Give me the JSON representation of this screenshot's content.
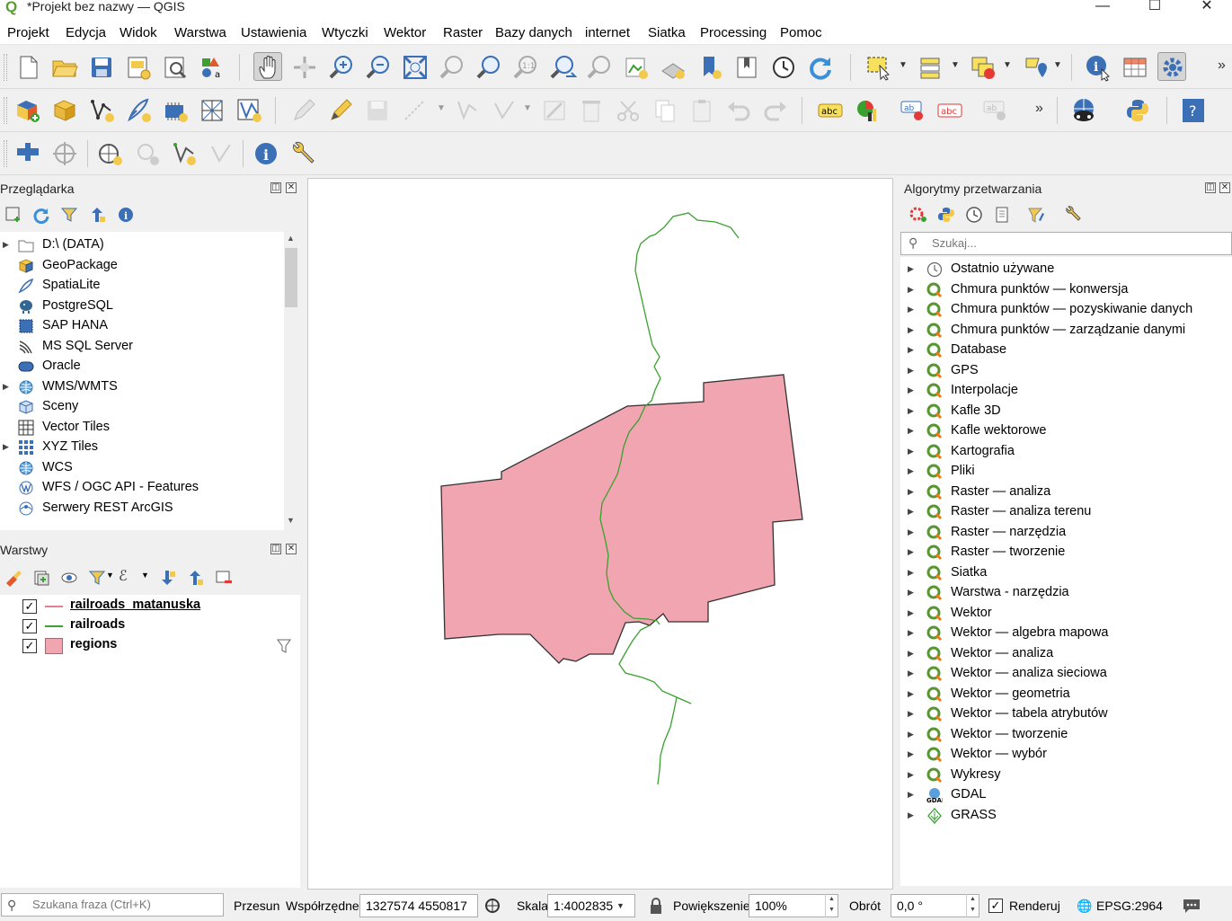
{
  "window": {
    "title": "*Projekt bez nazwy — QGIS",
    "minimize": "—",
    "maximize": "☐",
    "close": "✕"
  },
  "menu": [
    "Projekt",
    "Edycja",
    "Widok",
    "Warstwa",
    "Ustawienia",
    "Wtyczki",
    "Wektor",
    "Raster",
    "Bazy danych",
    "internet",
    "Siatka",
    "Processing",
    "Pomoc"
  ],
  "toolbar": {
    "more": "»"
  },
  "browser": {
    "title": "Przeglądarka",
    "items": [
      {
        "label": "D:\\ (DATA)",
        "icon": "folder-icon",
        "expandable": true
      },
      {
        "label": "GeoPackage",
        "icon": "geopackage-icon",
        "expandable": false
      },
      {
        "label": "SpatiaLite",
        "icon": "spatialite-icon",
        "expandable": false
      },
      {
        "label": "PostgreSQL",
        "icon": "postgresql-icon",
        "expandable": false
      },
      {
        "label": "SAP HANA",
        "icon": "sap-hana-icon",
        "expandable": false
      },
      {
        "label": "MS SQL Server",
        "icon": "mssql-icon",
        "expandable": false
      },
      {
        "label": "Oracle",
        "icon": "oracle-icon",
        "expandable": false
      },
      {
        "label": "WMS/WMTS",
        "icon": "globe-icon",
        "expandable": true
      },
      {
        "label": "Sceny",
        "icon": "scene-icon",
        "expandable": false
      },
      {
        "label": "Vector Tiles",
        "icon": "vector-tiles-icon",
        "expandable": false
      },
      {
        "label": "XYZ Tiles",
        "icon": "xyz-tiles-icon",
        "expandable": true
      },
      {
        "label": "WCS",
        "icon": "globe-icon",
        "expandable": false
      },
      {
        "label": "WFS / OGC API - Features",
        "icon": "wfs-icon",
        "expandable": false
      },
      {
        "label": "Serwery REST ArcGIS",
        "icon": "arcgis-icon",
        "expandable": false
      }
    ]
  },
  "layers": {
    "title": "Warstwy",
    "items": [
      {
        "label": "railroads_matanuska",
        "color": "#e87f8f",
        "type": "line",
        "checked": true,
        "underline": true
      },
      {
        "label": "railroads",
        "color": "#3aa02f",
        "type": "line",
        "checked": true,
        "underline": false
      },
      {
        "label": "regions",
        "color": "#f1a5b1",
        "type": "polygon",
        "checked": true,
        "underline": false
      }
    ]
  },
  "processing": {
    "title": "Algorytmy przetwarzania",
    "search_placeholder": "Szukaj...",
    "items": [
      {
        "label": "Ostatnio używane",
        "icon": "clock-icon"
      },
      {
        "label": "Chmura punktów — konwersja",
        "icon": "qgis-icon"
      },
      {
        "label": "Chmura punktów — pozyskiwanie danych",
        "icon": "qgis-icon"
      },
      {
        "label": "Chmura punktów — zarządzanie danymi",
        "icon": "qgis-icon"
      },
      {
        "label": "Database",
        "icon": "qgis-icon"
      },
      {
        "label": "GPS",
        "icon": "qgis-icon"
      },
      {
        "label": "Interpolacje",
        "icon": "qgis-icon"
      },
      {
        "label": "Kafle 3D",
        "icon": "qgis-icon"
      },
      {
        "label": "Kafle wektorowe",
        "icon": "qgis-icon"
      },
      {
        "label": "Kartografia",
        "icon": "qgis-icon"
      },
      {
        "label": "Pliki",
        "icon": "qgis-icon"
      },
      {
        "label": "Raster — analiza",
        "icon": "qgis-icon"
      },
      {
        "label": "Raster — analiza terenu",
        "icon": "qgis-icon"
      },
      {
        "label": "Raster — narzędzia",
        "icon": "qgis-icon"
      },
      {
        "label": "Raster — tworzenie",
        "icon": "qgis-icon"
      },
      {
        "label": "Siatka",
        "icon": "qgis-icon"
      },
      {
        "label": "Warstwa - narzędzia",
        "icon": "qgis-icon"
      },
      {
        "label": "Wektor",
        "icon": "qgis-icon"
      },
      {
        "label": "Wektor — algebra mapowa",
        "icon": "qgis-icon"
      },
      {
        "label": "Wektor — analiza",
        "icon": "qgis-icon"
      },
      {
        "label": "Wektor — analiza sieciowa",
        "icon": "qgis-icon"
      },
      {
        "label": "Wektor — geometria",
        "icon": "qgis-icon"
      },
      {
        "label": "Wektor — tabela atrybutów",
        "icon": "qgis-icon"
      },
      {
        "label": "Wektor — tworzenie",
        "icon": "qgis-icon"
      },
      {
        "label": "Wektor — wybór",
        "icon": "qgis-icon"
      },
      {
        "label": "Wykresy",
        "icon": "qgis-icon"
      },
      {
        "label": "GDAL",
        "icon": "gdal-icon"
      },
      {
        "label": "GRASS",
        "icon": "grass-icon"
      }
    ]
  },
  "map": {
    "region_fill": "#f1a5b1",
    "railroad_color": "#3aa02f"
  },
  "status": {
    "search_placeholder": "Szukana fraza (Ctrl+K)",
    "pan_label": "Przesun",
    "coords_label": "Współrzędne",
    "coords_value": "1327574  4550817",
    "scale_label": "Skala",
    "scale_value": "1:4002835",
    "magnifier_label": "Powiększenie",
    "magnifier_value": "100%",
    "rotation_label": "Obrót",
    "rotation_value": "0,0 °",
    "render_label": "Renderuj",
    "crs": "EPSG:2964"
  }
}
